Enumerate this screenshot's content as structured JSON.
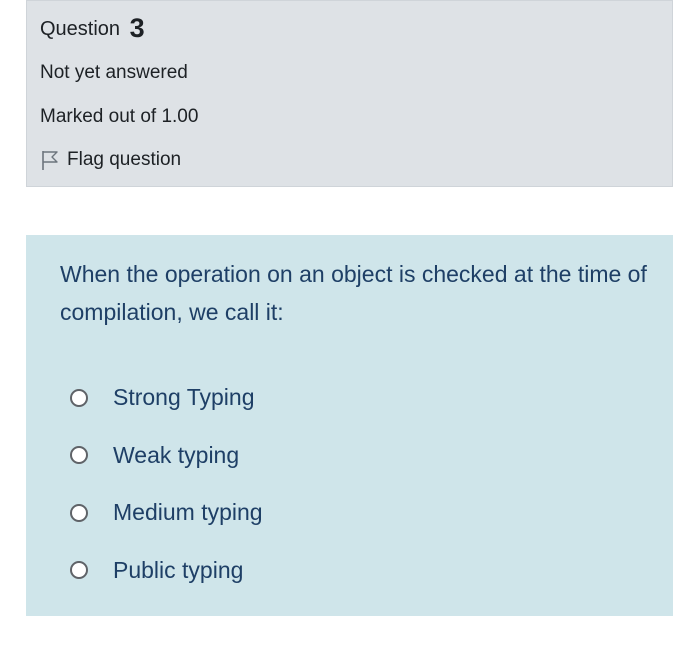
{
  "question_info": {
    "label": "Question",
    "number": "3",
    "state": "Not yet answered",
    "grade": "Marked out of 1.00",
    "flag_label": "Flag question",
    "flag_icon": "flag-icon"
  },
  "question": {
    "text": "When the operation on an object is checked at the time of compilation, we call it:",
    "answers": [
      {
        "label": "Strong Typing",
        "selected": false
      },
      {
        "label": "Weak typing",
        "selected": false
      },
      {
        "label": "Medium typing",
        "selected": false
      },
      {
        "label": "Public typing",
        "selected": false
      }
    ]
  },
  "colors": {
    "info_background": "#dee2e6",
    "content_background": "#cfe5ea",
    "question_text": "#1e3f66"
  }
}
